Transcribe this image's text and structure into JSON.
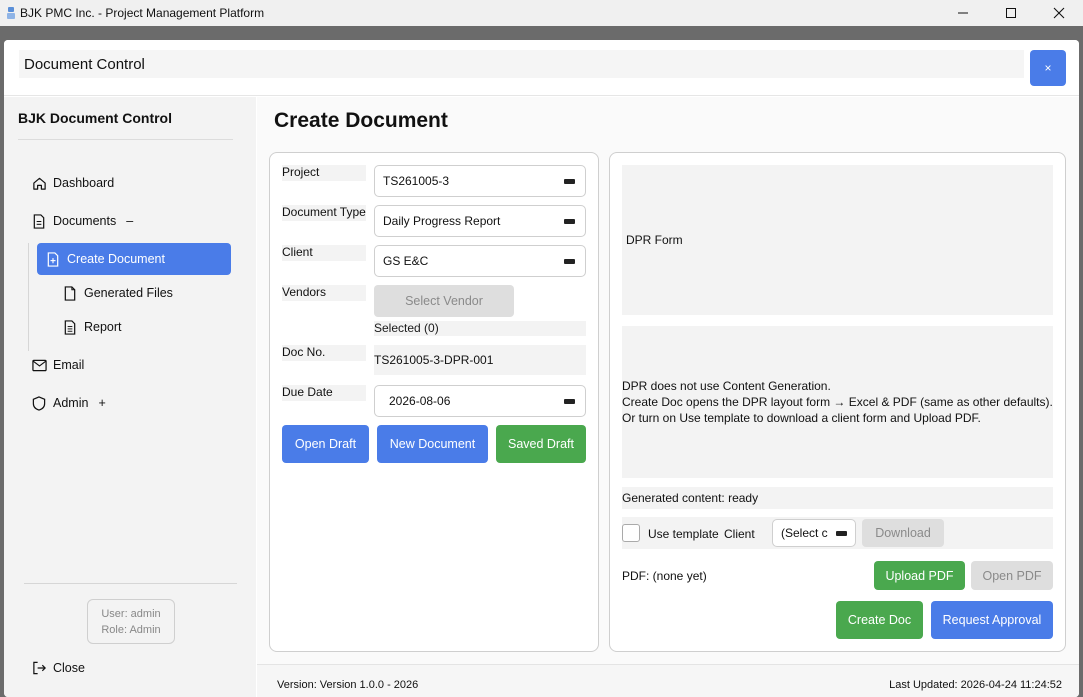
{
  "window": {
    "title": "BJK PMC Inc. - Project Management Platform",
    "controls": {
      "minimize": "—",
      "maximize": "☐",
      "close": "✕"
    }
  },
  "dialog": {
    "title": "Document Control",
    "close_label": "×"
  },
  "sidebar": {
    "title": "BJK Document Control",
    "items": [
      {
        "label": "Dashboard",
        "icon": "home-icon"
      },
      {
        "label": "Documents",
        "icon": "document-icon",
        "suffix": "–"
      },
      {
        "label": "Create Document",
        "icon": "document-plus-icon",
        "active": true
      },
      {
        "label": "Generated Files",
        "icon": "file-icon"
      },
      {
        "label": "Report",
        "icon": "report-icon"
      },
      {
        "label": "Email",
        "icon": "mail-icon"
      },
      {
        "label": "Admin",
        "icon": "shield-icon",
        "suffix": "+"
      }
    ],
    "user": "User: admin",
    "role": "Role: Admin",
    "close_label": "Close"
  },
  "main": {
    "title": "Create Document",
    "form": {
      "project_label": "Project",
      "project_value": "TS261005-3",
      "doctype_label": "Document Type",
      "doctype_value": "Daily Progress Report",
      "client_label": "Client",
      "client_value": "GS E&C",
      "vendors_label": "Vendors",
      "select_vendor_button": "Select Vendor",
      "selected_text": "Selected (0)",
      "docno_label": "Doc No.",
      "docno_value": "TS261005-3-DPR-001",
      "duedate_label": "Due Date",
      "duedate_value": "2026-08-06",
      "open_draft": "Open Draft",
      "new_document": "New Document",
      "saved_draft": "Saved Draft"
    },
    "right": {
      "form_title": "DPR Form",
      "info_lines": [
        "DPR does not use Content Generation.",
        "Create Doc opens the DPR layout form → Excel & PDF (same as other defaults).",
        "Or turn on Use template to download a client form and Upload PDF."
      ],
      "generated_status": "Generated content: ready",
      "use_template_label": "Use template",
      "client_label": "Client",
      "client_select_value": "(Select c",
      "download_button": "Download",
      "pdf_status": "PDF: (none yet)",
      "upload_pdf_button": "Upload PDF",
      "open_pdf_button": "Open PDF",
      "create_doc_button": "Create Doc",
      "request_approval_button": "Request Approval"
    },
    "footer": {
      "version": "Version: Version 1.0.0 - 2026",
      "last_updated": "Last Updated: 2026-04-24 11:24:52"
    }
  },
  "colors": {
    "accent_blue": "#4a7ce8",
    "accent_green": "#4aa84e",
    "disabled": "#dedede"
  }
}
